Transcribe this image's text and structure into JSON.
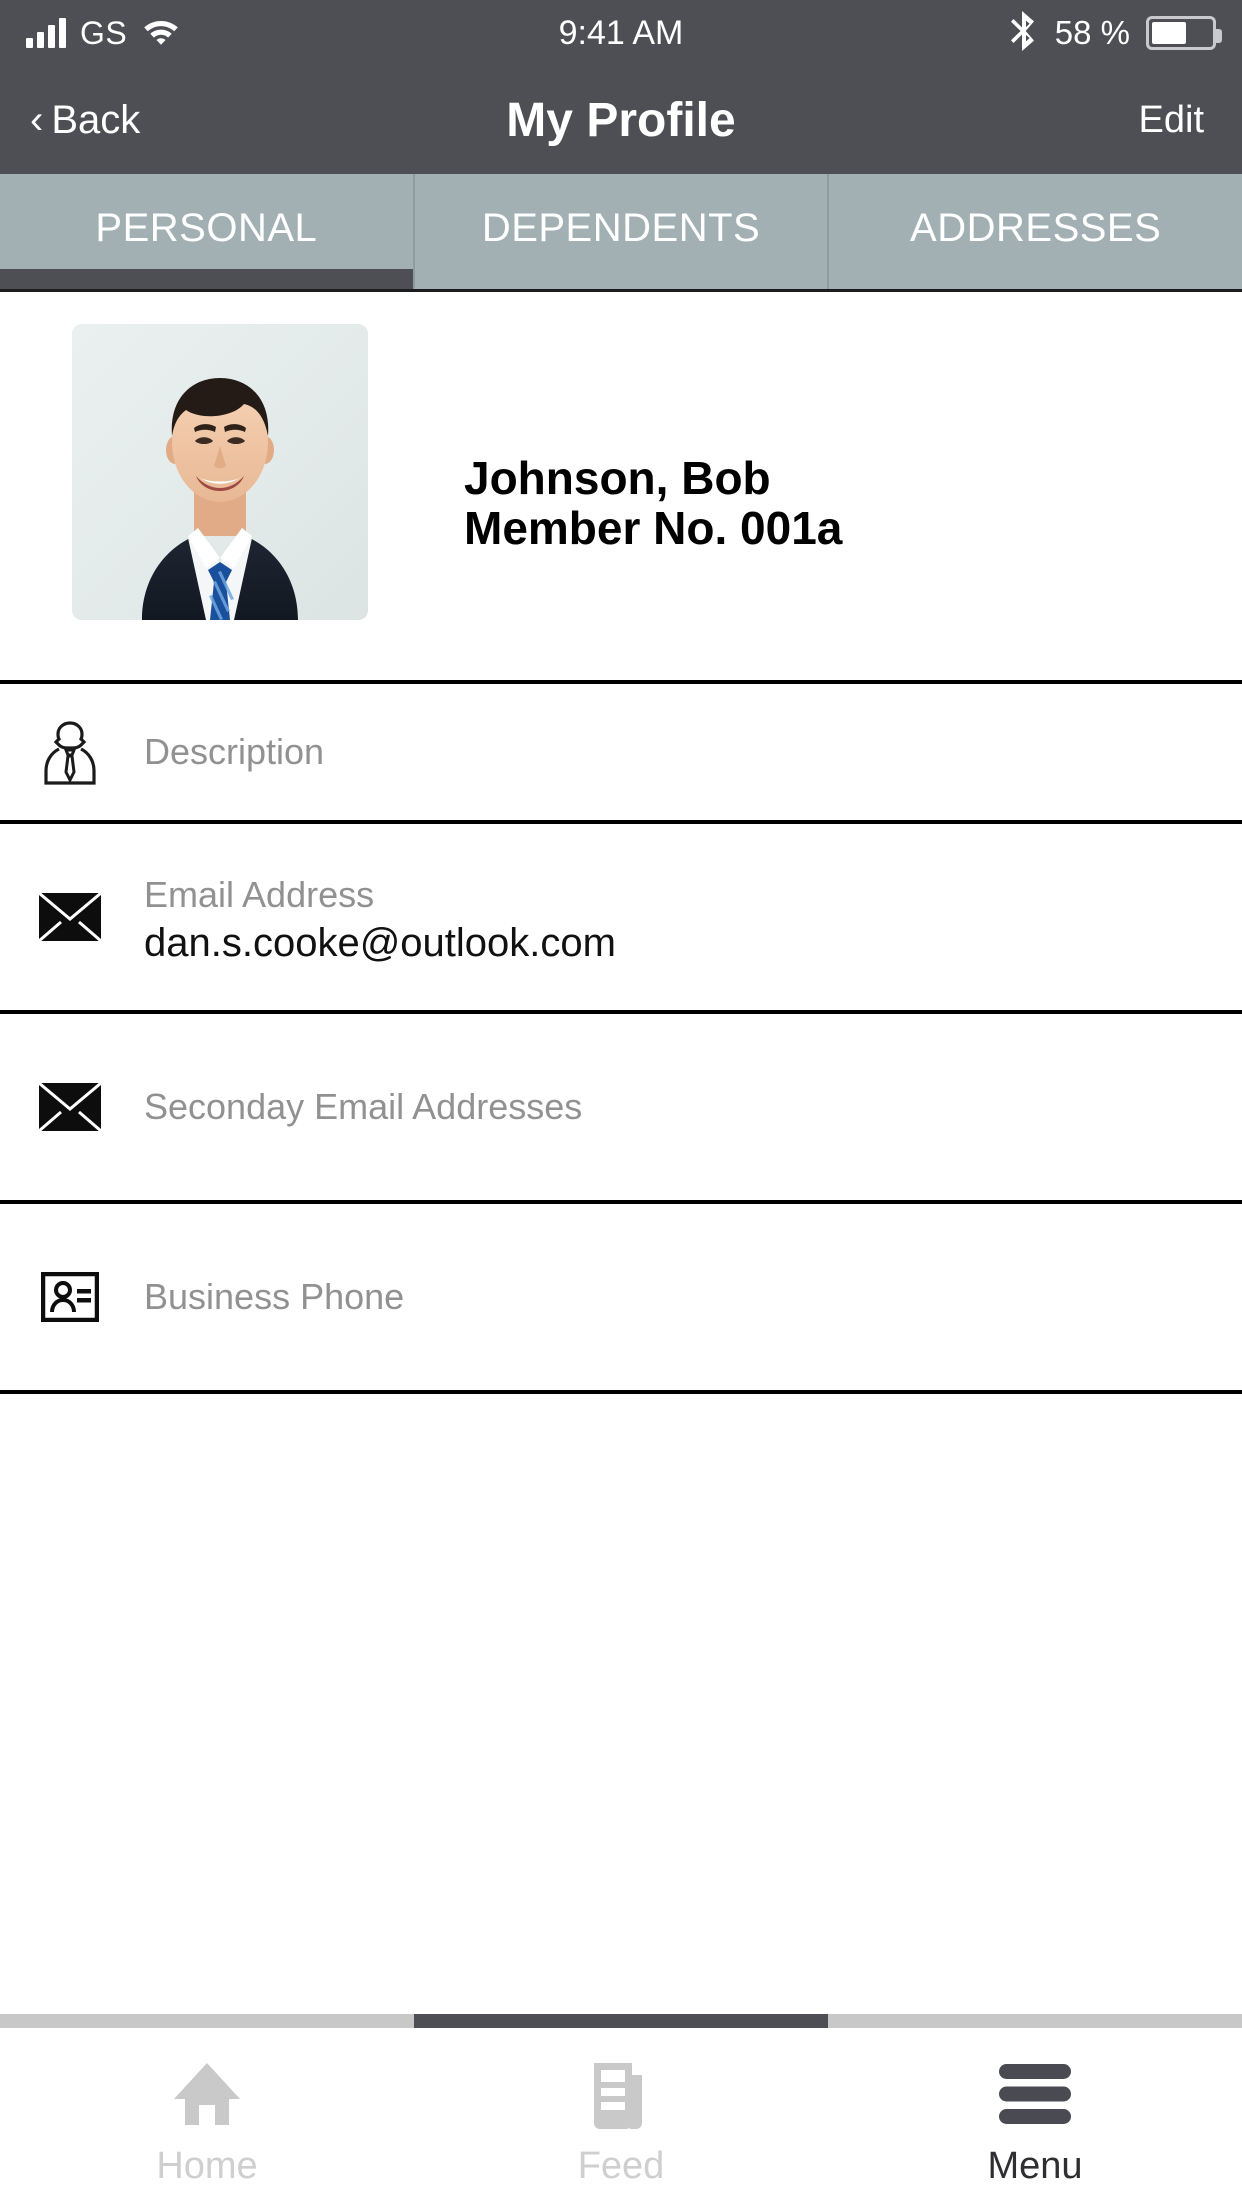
{
  "status_bar": {
    "carrier": "GS",
    "signal_icon": "signal-bars-icon",
    "wifi_icon": "wifi-icon",
    "time": "9:41 AM",
    "bluetooth_icon": "bluetooth-icon",
    "battery_percent": "58 %",
    "battery_level": 58,
    "battery_icon": "battery-icon",
    "background_color": "#4e4e55",
    "text_color": "#ffffff"
  },
  "nav_bar": {
    "back_label": "Back",
    "back_icon": "chevron-left-icon",
    "title": "My Profile",
    "edit_label": "Edit",
    "background_color": "#4e4e55"
  },
  "segment_tabs": {
    "background_color": "#a2b0b4",
    "active_indicator_color": "#4e4e55",
    "items": [
      {
        "label": "PERSONAL",
        "active": true
      },
      {
        "label": "DEPENDENTS",
        "active": false
      },
      {
        "label": "ADDRESSES",
        "active": false
      }
    ]
  },
  "profile": {
    "avatar_alt": "profile-photo",
    "name": "Johnson, Bob",
    "member_no": "Member No. 001a"
  },
  "fields": [
    {
      "icon": "person-tie-icon",
      "label": "Description",
      "value": "",
      "has_value": false
    },
    {
      "icon": "envelope-icon",
      "label": "Email Address",
      "value": "dan.s.cooke@outlook.com",
      "has_value": true
    },
    {
      "icon": "envelope-icon",
      "label": "Seconday Email Addresses",
      "value": "",
      "has_value": false
    },
    {
      "icon": "contact-card-icon",
      "label": "Business Phone",
      "value": "",
      "has_value": false
    }
  ],
  "scroll_indicator": {
    "track_color": "#c8c8c8",
    "thumb_color": "#4e4e55",
    "active_segment": 1,
    "segments": 3
  },
  "bottom_tabbar": {
    "items": [
      {
        "label": "Home",
        "icon": "home-icon",
        "active": false
      },
      {
        "label": "Feed",
        "icon": "feed-icon",
        "active": false
      },
      {
        "label": "Menu",
        "icon": "hamburger-menu-icon",
        "active": true
      }
    ],
    "inactive_color": "#cfcfcf",
    "active_color": "#2e2e33"
  }
}
